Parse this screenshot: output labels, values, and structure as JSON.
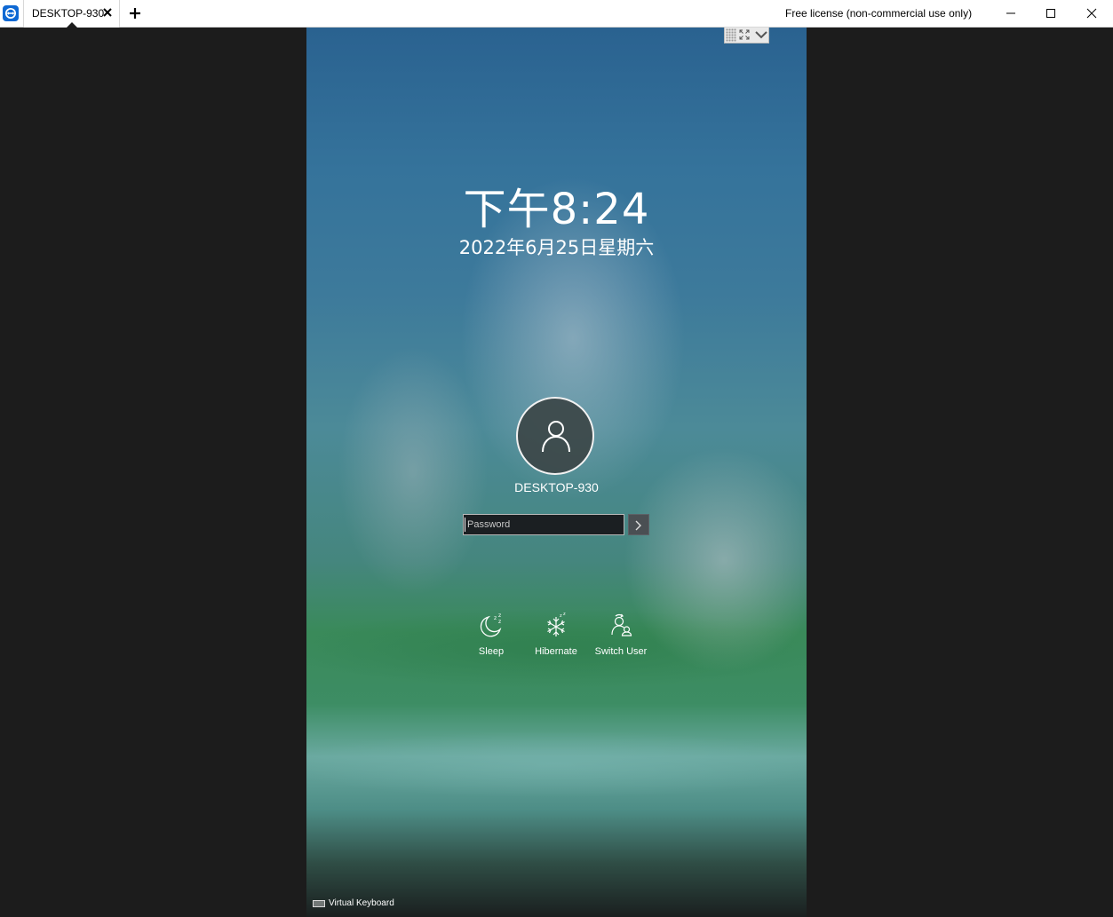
{
  "titlebar": {
    "tab_title": "DESKTOP-930",
    "license_text": "Free license (non-commercial use only)"
  },
  "lock_screen": {
    "time": "下午8:24",
    "date": "2022年6月25日星期六",
    "username": "DESKTOP-930",
    "password_placeholder": "Password",
    "power_options": [
      {
        "label": "Sleep",
        "icon": "sleep-moon-icon"
      },
      {
        "label": "Hibernate",
        "icon": "snowflake-icon"
      },
      {
        "label": "Switch User",
        "icon": "switch-user-icon"
      }
    ],
    "virtual_keyboard_label": "Virtual Keyboard"
  },
  "colors": {
    "window_background": "#1c1c1c",
    "app_accent": "#0e68d3"
  }
}
